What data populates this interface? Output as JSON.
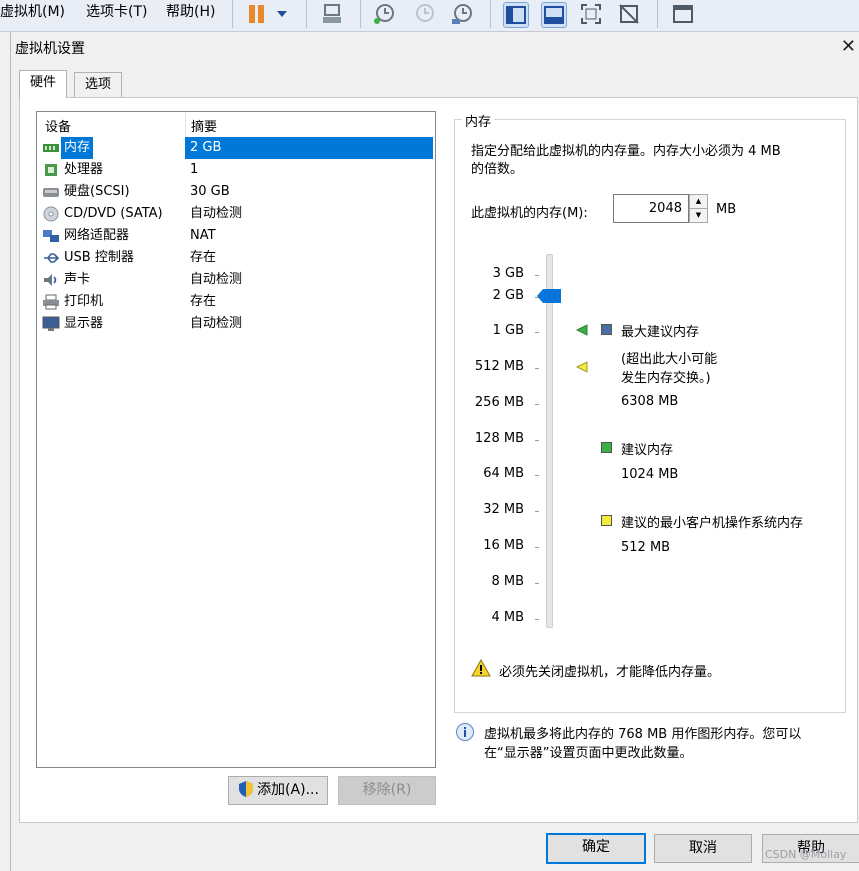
{
  "menubar": {
    "vm_menu": "虚拟机(M)",
    "tabs_menu": "选项卡(T)",
    "help_menu": "帮助(H)"
  },
  "dialog": {
    "title": "虚拟机设置",
    "close_glyph": "✕",
    "tabs": [
      {
        "label": "硬件"
      },
      {
        "label": "选项"
      }
    ]
  },
  "devices": {
    "col_device": "设备",
    "col_summary": "摘要",
    "rows": [
      {
        "name": "内存",
        "summary": "2 GB",
        "icon": "memory-icon",
        "selected": true
      },
      {
        "name": "处理器",
        "summary": "1",
        "icon": "processor-icon"
      },
      {
        "name": "硬盘(SCSI)",
        "summary": "30 GB",
        "icon": "harddisk-icon"
      },
      {
        "name": "CD/DVD (SATA)",
        "summary": "自动检测",
        "icon": "cd-dvd-icon"
      },
      {
        "name": "网络适配器",
        "summary": "NAT",
        "icon": "network-adapter-icon"
      },
      {
        "name": "USB 控制器",
        "summary": "存在",
        "icon": "usb-icon"
      },
      {
        "name": "声卡",
        "summary": "自动检测",
        "icon": "sound-card-icon"
      },
      {
        "name": "打印机",
        "summary": "存在",
        "icon": "printer-icon"
      },
      {
        "name": "显示器",
        "summary": "自动检测",
        "icon": "display-icon"
      }
    ],
    "add_label": "添加(A)...",
    "remove_label": "移除(R)"
  },
  "memory": {
    "group_title": "内存",
    "desc_line1": "指定分配给此虚拟机的内存量。内存大小必须为 4 MB",
    "desc_line2": "的倍数。",
    "field_label": "此虚拟机的内存(M):",
    "value": "2048",
    "unit": "MB",
    "scale_labels": [
      "3 GB",
      "2 GB",
      "1 GB",
      "512 MB",
      "256 MB",
      "128 MB",
      "64 MB",
      "32 MB",
      "16 MB",
      "8 MB",
      "4 MB"
    ],
    "current_value_label": "2 GB",
    "max_recommended": {
      "label": "最大建议内存",
      "note_line1": "(超出此大小可能",
      "note_line2": "发生内存交换。)",
      "value": "6308 MB",
      "color": "#4a6fa5"
    },
    "recommended": {
      "label": "建议内存",
      "value": "1024 MB",
      "color": "#3cb043"
    },
    "min_guest": {
      "label": "建议的最小客户机操作系统内存",
      "value": "512 MB",
      "color": "#f2ea3c"
    },
    "warning": "必须先关闭虚拟机，才能降低内存量。"
  },
  "info": {
    "line1": "虚拟机最多将此内存的 768 MB 用作图形内存。您可以",
    "line2": "在“显示器”设置页面中更改此数量。"
  },
  "footer": {
    "ok_label": "确定",
    "cancel_label": "取消",
    "help_label": "帮助",
    "watermark": "CSDN @Mollay"
  },
  "colors": {
    "selection": "#0078d7",
    "slider_thumb": "#0a74da"
  }
}
